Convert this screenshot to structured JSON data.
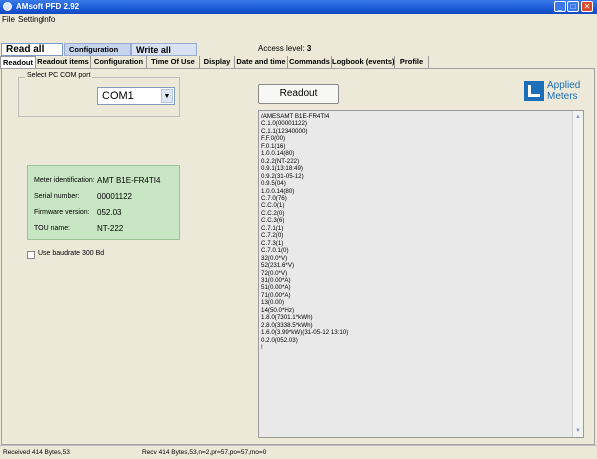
{
  "window": {
    "title": "AMsoft PFD 2.92"
  },
  "menu": [
    "File",
    "Setting",
    "Info"
  ],
  "toolbar": {
    "read_all": "Read all",
    "configuration": "Configuration",
    "write_all": "Write all"
  },
  "access": {
    "label": "Access level:",
    "value": "3"
  },
  "tabs": [
    "Readout",
    "Readout items",
    "Configuration",
    "Time Of Use",
    "Display",
    "Date and time",
    "Commands",
    "Logbook (events)",
    "Profile"
  ],
  "com_port": {
    "legend": "Select PC COM port",
    "value": "COM1"
  },
  "meter_info": {
    "identification": {
      "label": "Meter identification:",
      "value": "AMT B1E-FR4TI4"
    },
    "serial": {
      "label": "Serial number:",
      "value": "00001122"
    },
    "firmware": {
      "label": "Firmware version:",
      "value": "052.03"
    },
    "tou": {
      "label": "TOU name:",
      "value": "NT-222"
    }
  },
  "baudrate": {
    "label": "Use baudrate 300 Bd",
    "checked": false
  },
  "readout_button": "Readout",
  "logo": {
    "line1": "Applied",
    "line2": "Meters"
  },
  "readout_lines": [
    "/AMESAMT B1E-FR4TI4",
    "C.1.0(00001122)",
    "C.1.1(12340000)",
    "F.F.0(00)",
    "F.0.1(16)",
    "1.0.0.14(80)",
    "0.2.2(NT-222)",
    "0.9.1(13:18:49)",
    "0.9.2(31-05-12)",
    "0.9.5(04)",
    "1.0.0.14(80)",
    "C.7.0(76)",
    "C.C.0(1)",
    "C.C.2(0)",
    "C.C.3(6)",
    "C.7.1(1)",
    "C.7.2(0)",
    "C.7.3(1)",
    "C.7.0.1(0)",
    "32(0.0*V)",
    "52(231.6*V)",
    "72(0.0*V)",
    "31(0.00*A)",
    "51(0.00*A)",
    "71(0.00*A)",
    "13(0.00)",
    "14(50.0*Hz)",
    "1.8.0(7301.1*kWh)",
    "2.8.0(3338.5*kWh)",
    "1.6.0(3.99*kW)(31-05-12 13:10)",
    "0.2.0(052.03)",
    "!"
  ],
  "status": {
    "left": "Received 414 Bytes,53",
    "right": "Recv 414 Bytes,53,n=2,pr=57,po=57,mo=0"
  }
}
